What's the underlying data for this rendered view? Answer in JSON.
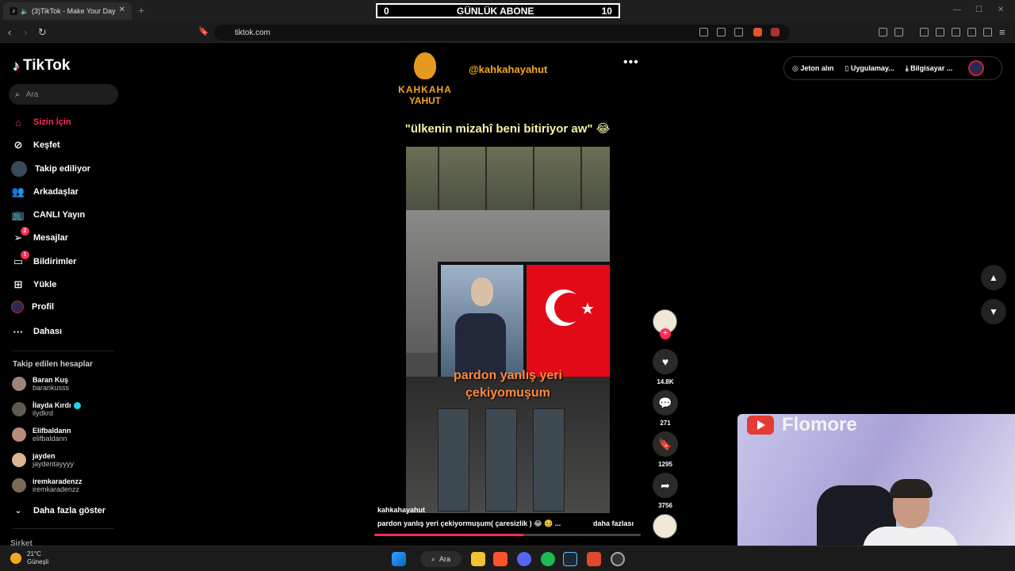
{
  "browser": {
    "tab_title": "(3)TikTok - Make Your Day",
    "tab_close": "✕",
    "new_tab": "+",
    "url": "tiktok.com",
    "minimize": "—",
    "maximize": "☐",
    "close": "✕"
  },
  "overlay_counter": {
    "left": "0",
    "title": "GÜNLÜK ABONE",
    "right": "10"
  },
  "sidebar": {
    "logo": "TikTok",
    "search_placeholder": "Ara",
    "nav": [
      {
        "label": "Sizin İçin",
        "active": true
      },
      {
        "label": "Keşfet"
      },
      {
        "label": "Takip ediliyor"
      },
      {
        "label": "Arkadaşlar"
      },
      {
        "label": "CANLI Yayın"
      },
      {
        "label": "Mesajlar",
        "badge": "2"
      },
      {
        "label": "Bildirimler",
        "badge": "1"
      },
      {
        "label": "Yükle"
      },
      {
        "label": "Profil"
      },
      {
        "label": "Dahası"
      }
    ],
    "following_title": "Takip edilen hesaplar",
    "accounts": [
      {
        "name": "Baran Kuş",
        "user": "barankusss"
      },
      {
        "name": "İlayda Kırdı",
        "user": "ilydkrd"
      },
      {
        "name": "Elifbaldann",
        "user": "elifbaldann"
      },
      {
        "name": "jayden",
        "user": "jaydentayyyy"
      },
      {
        "name": "iremkaradenzz",
        "user": "iremkaradenzz"
      }
    ],
    "show_more": "Daha fazla göster",
    "company": "Şirket"
  },
  "video": {
    "brand_line1": "KAHKAHA",
    "brand_line2": "YAHUT",
    "handle": "@kahkahayahut",
    "more": "•••",
    "top_caption": "\"ülkenin mizahî beni bitiriyor aw\" 😂",
    "overlay_line1": "pardon yanlış yeri",
    "overlay_line2": "çekiyomuşum",
    "author": "kahkahayahut",
    "description": "pardon yanlış yeri çekiyormuşum( çaresizlik ) 😂 🥹 ...",
    "more_link": "daha fazlası",
    "progress": 0.56
  },
  "actions": {
    "follow_plus": "+",
    "likes": "14.8K",
    "comments": "271",
    "saves": "1295",
    "shares": "3756"
  },
  "top_right": {
    "coins": "Jeton alın",
    "app": "Uygulamay...",
    "desktop": "Bilgisayar ..."
  },
  "webcam": {
    "brand": "Flomore"
  },
  "taskbar": {
    "temp": "21°C",
    "condition": "Güneşli",
    "search": "Ara"
  },
  "colors": {
    "accent": "#fe2c55",
    "brand_orange": "#f5a623",
    "caption_yellow": "#f6f3a9"
  }
}
